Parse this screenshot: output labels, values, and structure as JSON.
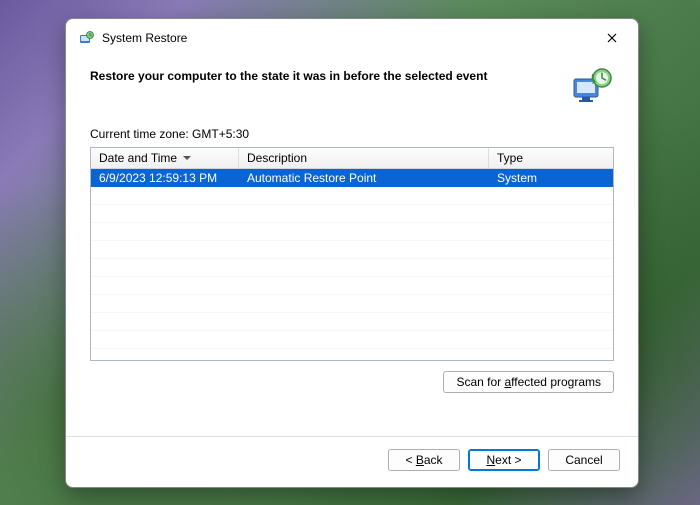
{
  "window": {
    "title": "System Restore"
  },
  "header": {
    "heading": "Restore your computer to the state it was in before the selected event"
  },
  "timezone_label": "Current time zone: GMT+5:30",
  "table": {
    "columns": {
      "date": "Date and Time",
      "description": "Description",
      "type": "Type"
    },
    "rows": [
      {
        "date": "6/9/2023 12:59:13 PM",
        "description": "Automatic Restore Point",
        "type": "System",
        "selected": true
      }
    ]
  },
  "buttons": {
    "scan": "Scan for affected programs",
    "back": "< Back",
    "next": "Next >",
    "cancel": "Cancel"
  }
}
